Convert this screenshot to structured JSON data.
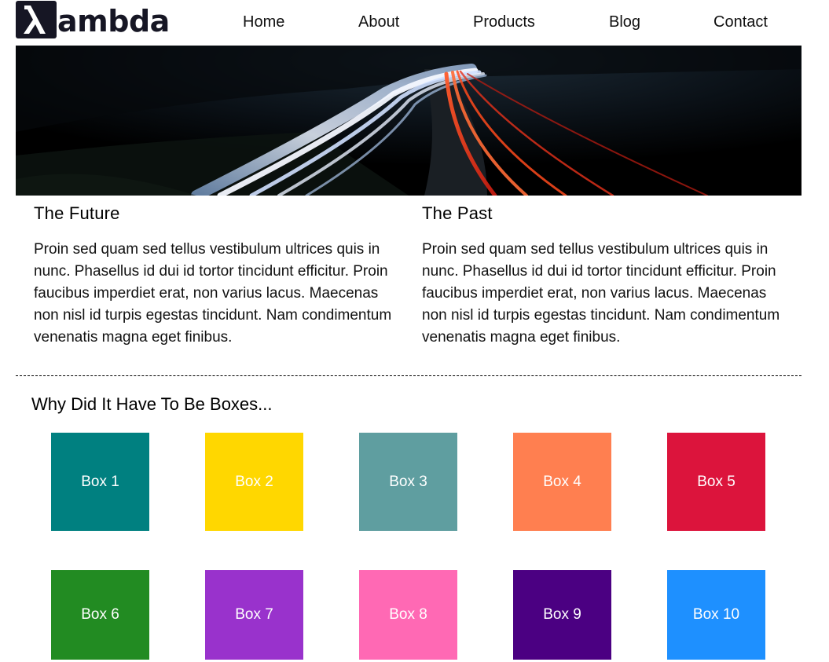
{
  "header": {
    "logo": {
      "lambda_glyph": "λ",
      "text": "ambda"
    },
    "nav": [
      {
        "label": "Home"
      },
      {
        "label": "About"
      },
      {
        "label": "Products"
      },
      {
        "label": "Blog"
      },
      {
        "label": "Contact"
      }
    ]
  },
  "sections": [
    {
      "title": "The Future",
      "body": "Proin sed quam sed tellus vestibulum ultrices quis in nunc. Phasellus id dui id tortor tincidunt efficitur. Proin faucibus imperdiet erat, non varius lacus. Maecenas non nisl id turpis egestas tincidunt. Nam condimentum venenatis magna eget finibus."
    },
    {
      "title": "The Past",
      "body": "Proin sed quam sed tellus vestibulum ultrices quis in nunc. Phasellus id dui id tortor tincidunt efficitur. Proin faucibus imperdiet erat, non varius lacus. Maecenas non nisl id turpis egestas tincidunt. Nam condimentum venenatis magna eget finibus."
    }
  ],
  "boxes_section": {
    "title": "Why Did It Have To Be Boxes...",
    "boxes": [
      {
        "label": "Box 1",
        "color": "#008080"
      },
      {
        "label": "Box 2",
        "color": "#FFD700"
      },
      {
        "label": "Box 3",
        "color": "#5F9EA0"
      },
      {
        "label": "Box 4",
        "color": "#FF7F50"
      },
      {
        "label": "Box 5",
        "color": "#DC143C"
      },
      {
        "label": "Box 6",
        "color": "#228B22"
      },
      {
        "label": "Box 7",
        "color": "#9932CC"
      },
      {
        "label": "Box 8",
        "color": "#FF69B4"
      },
      {
        "label": "Box 9",
        "color": "#4B0082"
      },
      {
        "label": "Box 10",
        "color": "#1E90FF"
      }
    ]
  }
}
